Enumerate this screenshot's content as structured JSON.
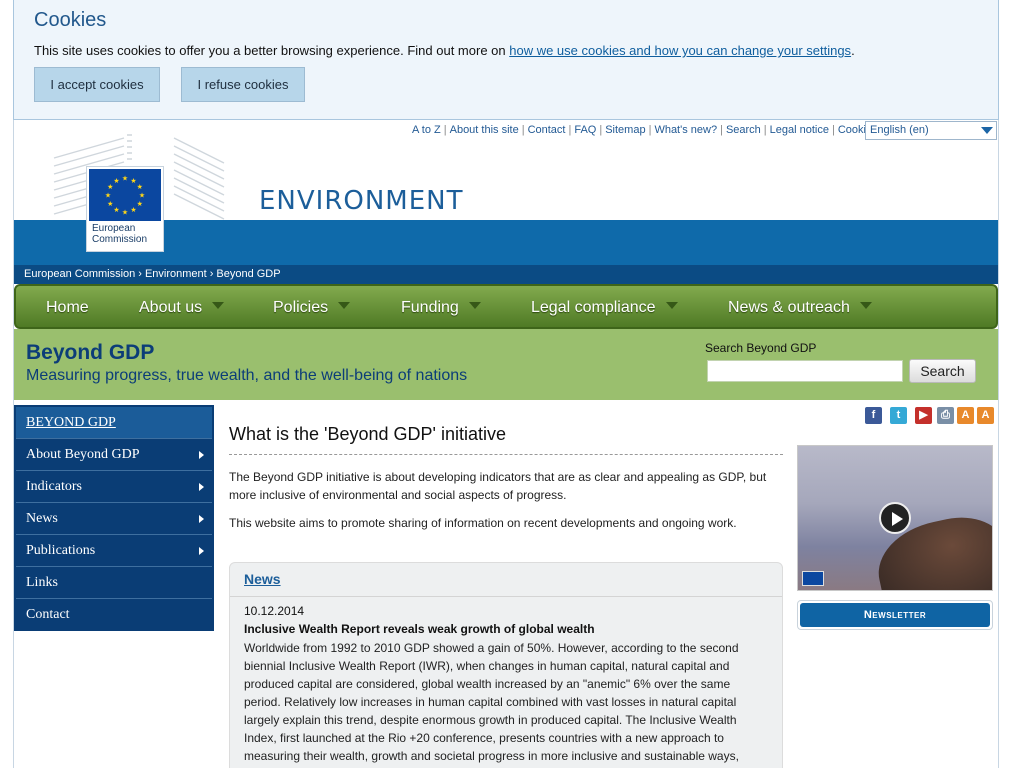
{
  "cookie": {
    "title": "Cookies",
    "text": "This site uses cookies to offer you a better browsing experience. Find out more on ",
    "link": "how we use cookies and how you can change your settings",
    "after_link": ".",
    "accept_label": "I accept cookies",
    "refuse_label": "I refuse cookies"
  },
  "toplinks": [
    "A to Z",
    "About this site",
    "Contact",
    "FAQ",
    "Sitemap",
    "What's new?",
    "Search",
    "Legal notice",
    "Cookies"
  ],
  "language": "English (en)",
  "header": {
    "logo_line1": "European",
    "logo_line2": "Commission",
    "title": "ENVIRONMENT"
  },
  "breadcrumb": [
    "European Commission",
    "Environment",
    "Beyond GDP"
  ],
  "mainnav": [
    {
      "label": "Home",
      "has_menu": false
    },
    {
      "label": "About us",
      "has_menu": true
    },
    {
      "label": "Policies",
      "has_menu": true
    },
    {
      "label": "Funding",
      "has_menu": true
    },
    {
      "label": "Legal compliance",
      "has_menu": true
    },
    {
      "label": "News & outreach",
      "has_menu": true
    }
  ],
  "site": {
    "title": "Beyond GDP",
    "subtitle": "Measuring progress, true wealth, and the well-being of nations",
    "search_label": "Search Beyond GDP",
    "search_value": "",
    "search_button": "Search"
  },
  "sidebar": [
    {
      "label": "BEYOND GDP",
      "arrow": false
    },
    {
      "label": "About Beyond GDP",
      "arrow": true
    },
    {
      "label": "Indicators",
      "arrow": true
    },
    {
      "label": "News",
      "arrow": true
    },
    {
      "label": "Publications",
      "arrow": true
    },
    {
      "label": "Links",
      "arrow": false
    },
    {
      "label": "Contact",
      "arrow": false
    }
  ],
  "share_icons": [
    {
      "name": "facebook-icon",
      "glyph": "f",
      "color": "#3b5998"
    },
    {
      "name": "twitter-icon",
      "glyph": "t",
      "color": "#35a9d6"
    },
    {
      "name": "youtube-icon",
      "glyph": "▶",
      "color": "#c4302b"
    },
    {
      "name": "print-icon",
      "glyph": "⎙",
      "color": "#7a8fa6"
    },
    {
      "name": "font-decrease-icon",
      "glyph": "A",
      "color": "#e8892b"
    },
    {
      "name": "font-increase-icon",
      "glyph": "A",
      "color": "#e8892b"
    }
  ],
  "content": {
    "title": "What is the 'Beyond GDP' initiative",
    "para1": "The Beyond GDP initiative is about developing indicators that are as clear and appealing as GDP, but more inclusive of environmental and social aspects of progress.",
    "para2": "This website aims to promote sharing of information on recent developments and ongoing work."
  },
  "news": {
    "heading": "News",
    "date": "10.12.2014",
    "title": "Inclusive Wealth Report reveals weak growth of global wealth",
    "body": "Worldwide from 1992 to 2010 GDP showed a gain of 50%. However, according to the second biennial Inclusive Wealth Report (IWR), when changes in human capital, natural capital and produced capital are considered, global wealth increased by an \"anemic\" 6% over the same period. Relatively low increases in human capital combined with vast losses in natural capital largely explain this trend, despite enormous growth in produced capital. The Inclusive Wealth Index, first launched at the Rio +20 conference, presents countries with a new approach to measuring their wealth, growth and societal progress in more inclusive and sustainable ways,"
  },
  "newsletter_label": "Newsletter"
}
